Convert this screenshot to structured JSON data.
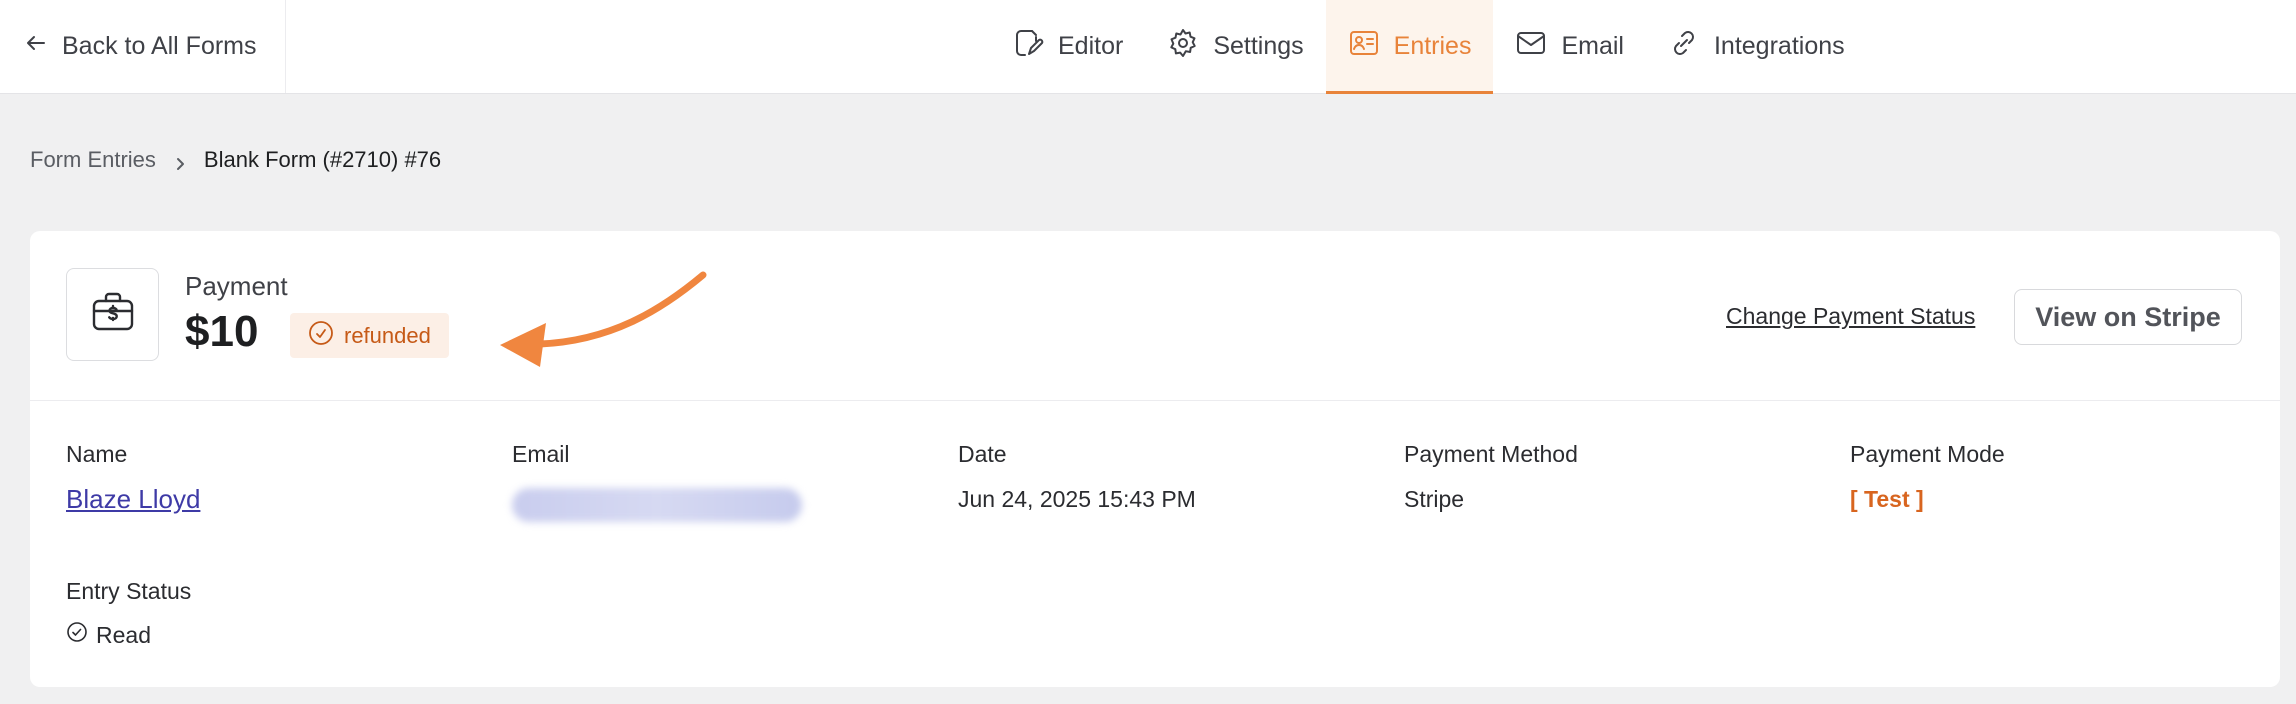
{
  "topbar": {
    "back_label": "Back to All Forms",
    "tabs": [
      {
        "label": "Editor",
        "icon": "editor-icon",
        "active": false
      },
      {
        "label": "Settings",
        "icon": "gear-icon",
        "active": false
      },
      {
        "label": "Entries",
        "icon": "id-card-icon",
        "active": true
      },
      {
        "label": "Email",
        "icon": "envelope-icon",
        "active": false
      },
      {
        "label": "Integrations",
        "icon": "link-icon",
        "active": false
      }
    ]
  },
  "breadcrumb": {
    "parent": "Form Entries",
    "current": "Blank Form (#2710) #76"
  },
  "payment": {
    "label": "Payment",
    "amount": "$10",
    "status": "refunded",
    "change_status_label": "Change Payment Status",
    "view_stripe_label": "View on Stripe"
  },
  "details": {
    "name_label": "Name",
    "name_value": "Blaze Lloyd",
    "email_label": "Email",
    "date_label": "Date",
    "date_value": "Jun 24, 2025 15:43 PM",
    "method_label": "Payment Method",
    "method_value": "Stripe",
    "mode_label": "Payment Mode",
    "mode_value": "[ Test ]",
    "entry_status_label": "Entry Status",
    "entry_status_value": "Read"
  },
  "colors": {
    "accent": "#e8833a",
    "badge_bg": "#fcefe6",
    "badge_text": "#c65a17",
    "link": "#3e3aa6"
  }
}
